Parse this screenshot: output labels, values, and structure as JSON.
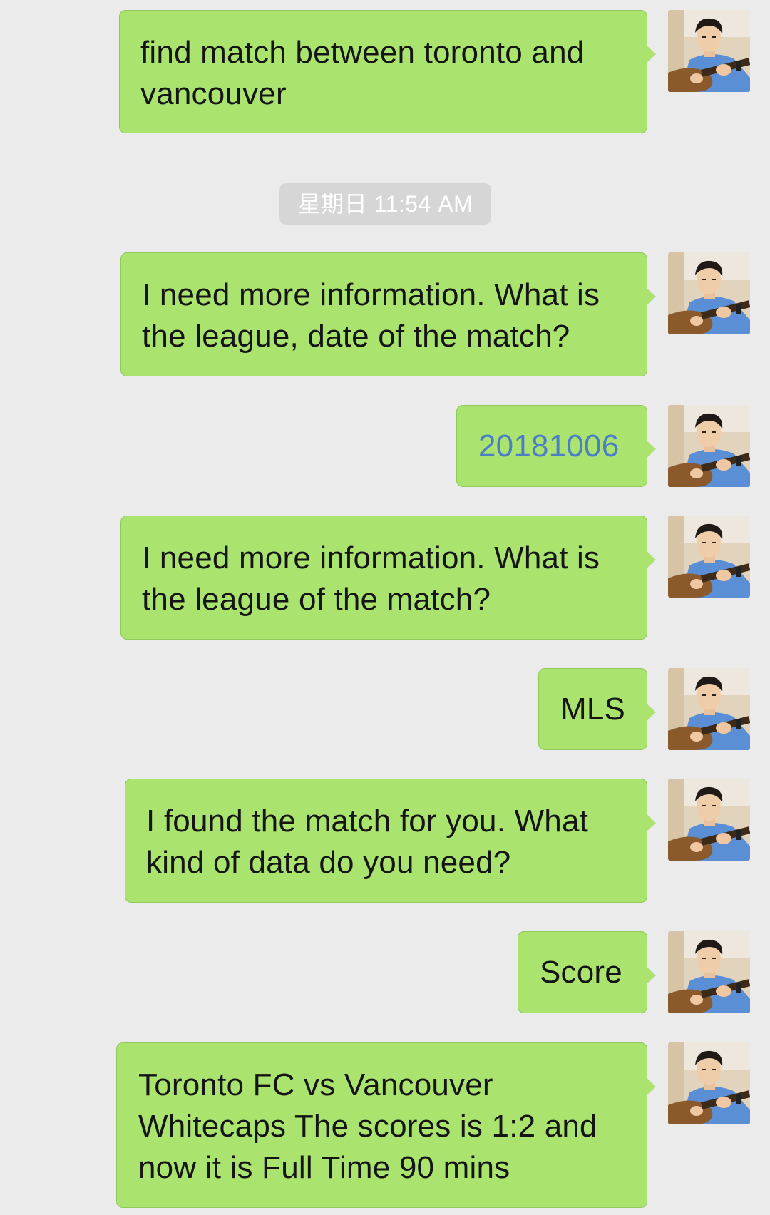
{
  "timestamp": "星期日 11:54 AM",
  "messages": [
    {
      "text": "find match between toronto and\nvancouver"
    },
    {
      "text": "I need more information. What is\n the league, date of the match?"
    },
    {
      "text": "20181006"
    },
    {
      "text": "I need more information. What is\n the league of the match?"
    },
    {
      "text": "MLS"
    },
    {
      "text": "I found the match for you. What\nkind of data do you need?"
    },
    {
      "text": "Score"
    },
    {
      "text": "Toronto FC vs Vancouver\nWhitecaps The scores is 1:2 and\nnow it is Full Time 90 mins"
    }
  ],
  "colors": {
    "background": "#ebebeb",
    "bubble": "#abe36f",
    "link": "#4b7ec6",
    "timestamp_bg": "#d6d6d6"
  },
  "avatar_icon": "user-avatar-icon"
}
